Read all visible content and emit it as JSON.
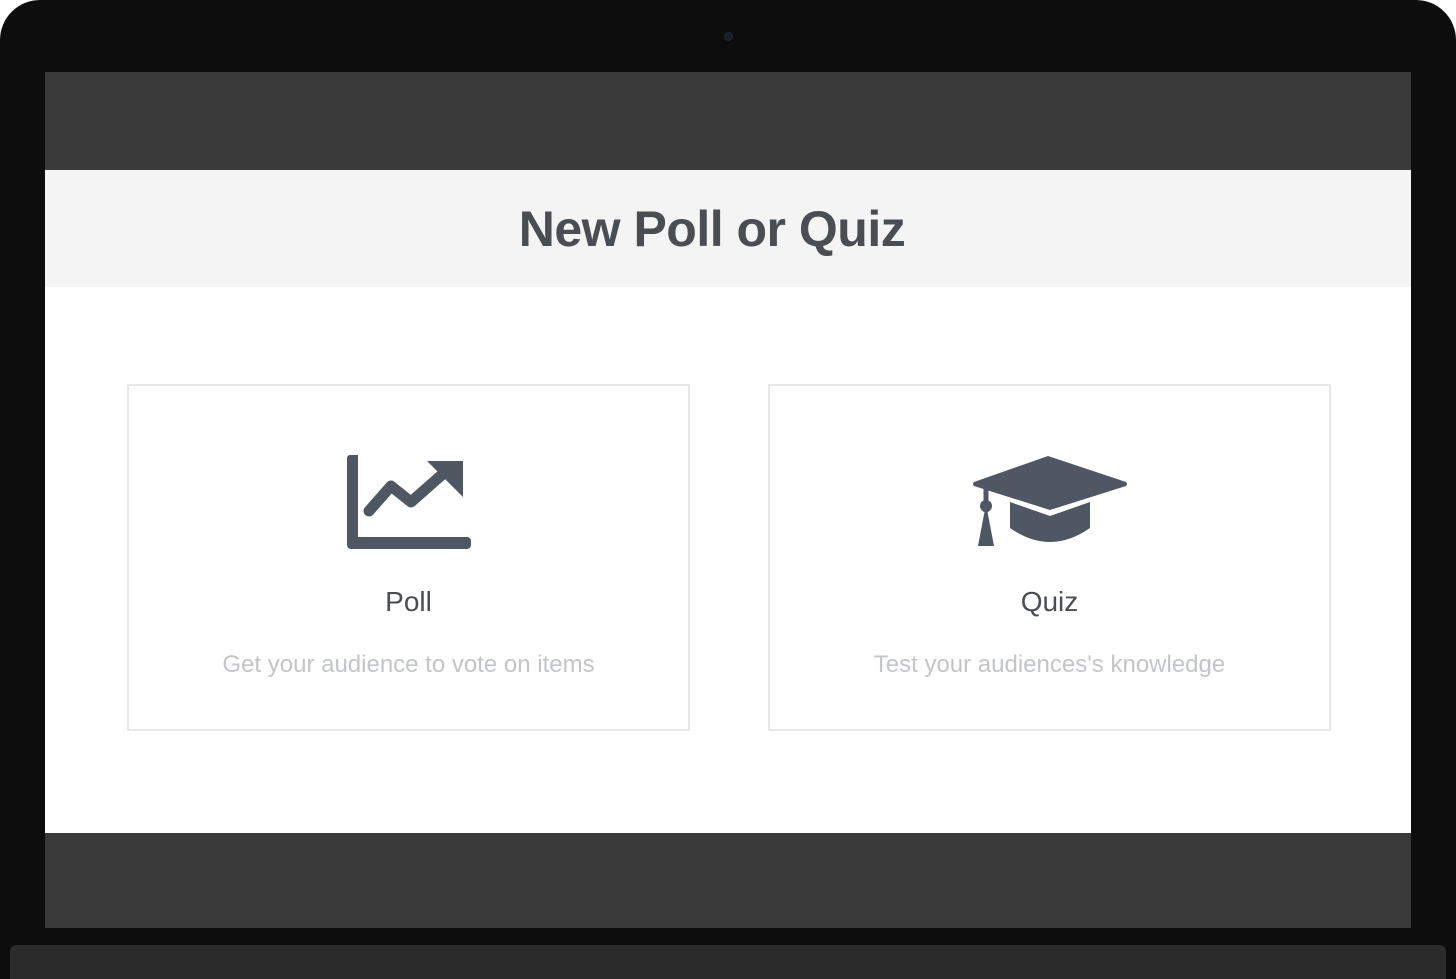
{
  "dialog": {
    "title": "New Poll or Quiz"
  },
  "options": [
    {
      "icon": "chart-trend-icon",
      "title": "Poll",
      "description": "Get your audience to vote on items"
    },
    {
      "icon": "graduation-cap-icon",
      "title": "Quiz",
      "description": "Test your audiences's knowledge"
    }
  ],
  "colors": {
    "frame": "#0d0d0d",
    "screen_bar": "#3a3a3a",
    "header_bg": "#f4f4f4",
    "title_text": "#4a4d52",
    "icon": "#4f5763",
    "desc_text": "#c3c5c8",
    "card_border": "#e8e8e8"
  }
}
